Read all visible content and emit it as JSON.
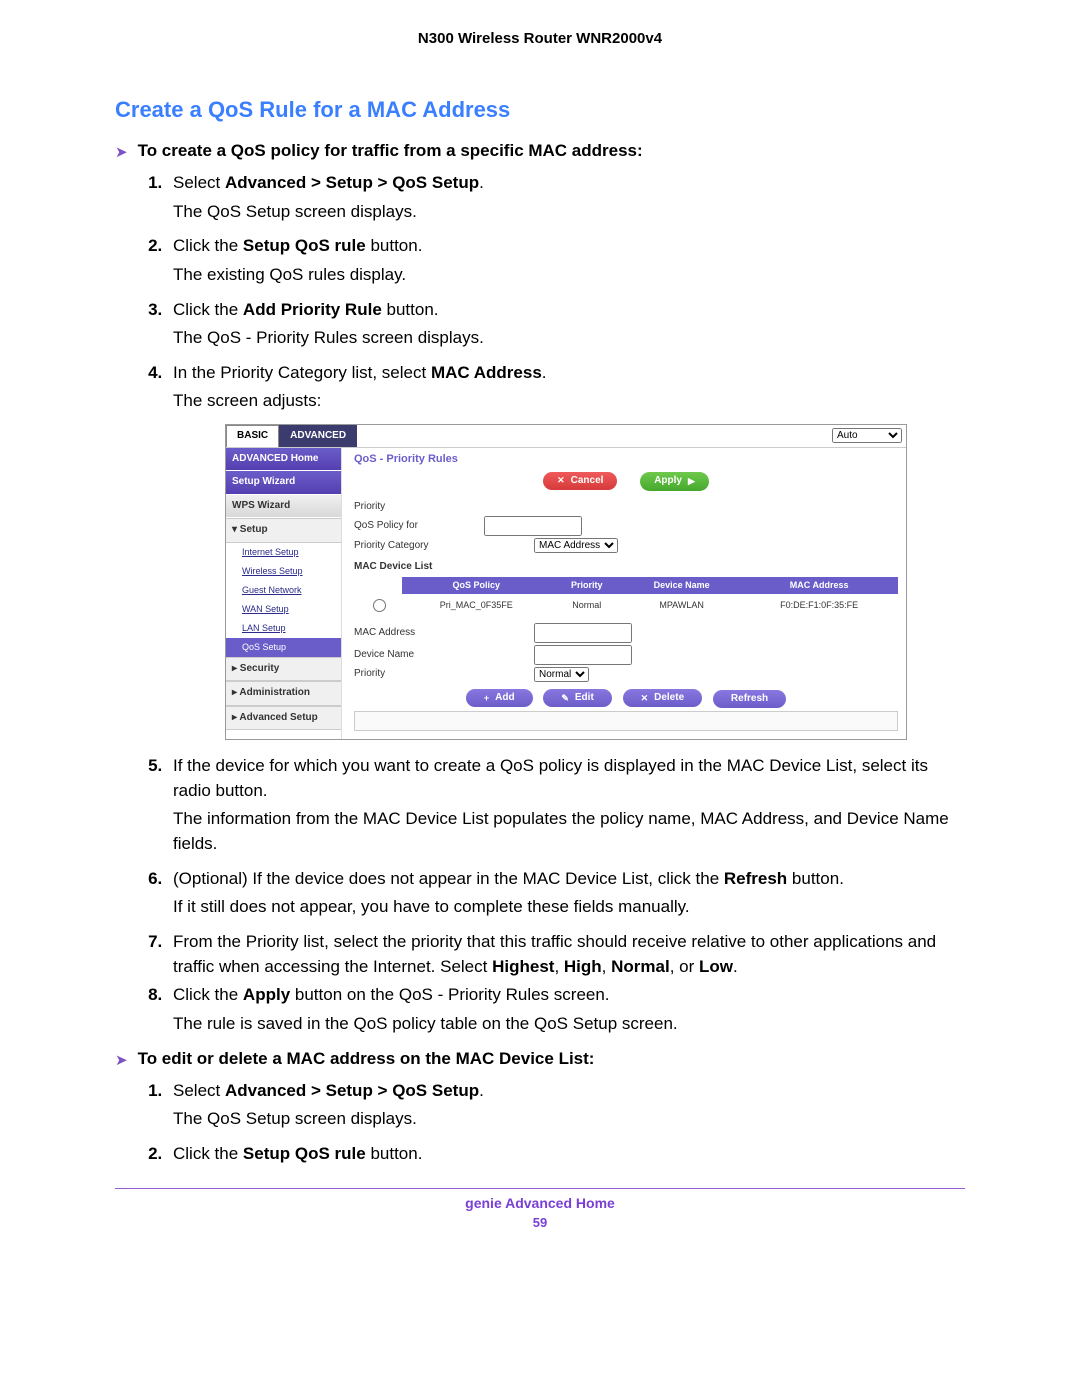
{
  "doc_header": "N300 Wireless Router WNR2000v4",
  "section_title": "Create a QoS Rule for a MAC Address",
  "intro_arrow": "To create a QoS policy for traffic from a specific MAC address:",
  "steps": {
    "s1a": "Select ",
    "s1bold": "Advanced > Setup > QoS Setup",
    "s1b": ".",
    "s1p": "The QoS Setup screen displays.",
    "s2a": "Click the ",
    "s2bold": "Setup QoS rule",
    "s2b": " button.",
    "s2p": "The existing QoS rules display.",
    "s3a": "Click the ",
    "s3bold": "Add Priority Rule",
    "s3b": " button.",
    "s3p": "The QoS - Priority Rules screen displays.",
    "s4a": "In the Priority Category list, select ",
    "s4bold": "MAC Address",
    "s4b": ".",
    "s4p": "The screen adjusts:",
    "s5": "If the device for which you want to create a QoS policy is displayed in the MAC Device List, select its radio button.",
    "s5p": "The information from the MAC Device List populates the policy name, MAC Address, and Device Name fields.",
    "s6a": "(Optional) If the device does not appear in the MAC Device List, click the ",
    "s6bold": "Refresh",
    "s6b": " button.",
    "s6p": "If it still does not appear, you have to complete these fields manually.",
    "s7a": "From the Priority list, select the priority that this traffic should receive relative to other applications and traffic when accessing the Internet. Select ",
    "s7b1": "Highest",
    "s7c1": ", ",
    "s7b2": "High",
    "s7c2": ", ",
    "s7b3": "Normal",
    "s7c3": ", or ",
    "s7b4": "Low",
    "s7c4": ".",
    "s8a": "Click the ",
    "s8bold": "Apply",
    "s8b": " button on the QoS - Priority Rules screen.",
    "s8p": "The rule is saved in the QoS policy table on the QoS Setup screen."
  },
  "edit_arrow": "To edit or delete a MAC address on the MAC Device List:",
  "edit_steps": {
    "e1a": "Select ",
    "e1bold": "Advanced > Setup > QoS Setup",
    "e1b": ".",
    "e1p": "The QoS Setup screen displays.",
    "e2a": "Click the ",
    "e2bold": "Setup QoS rule",
    "e2b": " button."
  },
  "router": {
    "tabs": {
      "basic": "BASIC",
      "advanced": "ADVANCED"
    },
    "auto": "Auto",
    "side": {
      "adv_home": "ADVANCED Home",
      "setup_wizard": "Setup Wizard",
      "wps_wizard": "WPS Wizard",
      "setup": "▾ Setup",
      "links": [
        "Internet Setup",
        "Wireless Setup",
        "Guest Network",
        "WAN Setup",
        "LAN Setup",
        "QoS Setup"
      ],
      "security": "▸ Security",
      "administration": "▸ Administration",
      "adv_setup": "▸ Advanced Setup"
    },
    "main": {
      "title": "QoS - Priority Rules",
      "cancel": "Cancel",
      "apply": "Apply",
      "priority_lbl": "Priority",
      "policy_lbl": "QoS Policy for",
      "category_lbl": "Priority Category",
      "category_val": "MAC Address",
      "devlist_lbl": "MAC Device List",
      "th": {
        "policy": "QoS Policy",
        "priority": "Priority",
        "device": "Device Name",
        "mac": "MAC Address"
      },
      "row": {
        "policy": "Pri_MAC_0F35FE",
        "priority": "Normal",
        "device": "MPAWLAN",
        "mac": "F0:DE:F1:0F:35:FE"
      },
      "mac_lbl": "MAC Address",
      "devname_lbl": "Device Name",
      "priority2_lbl": "Priority",
      "priority2_val": "Normal",
      "add": "Add",
      "edit": "Edit",
      "delete": "Delete",
      "refresh": "Refresh"
    }
  },
  "footer": {
    "line1": "genie Advanced Home",
    "page": "59"
  }
}
